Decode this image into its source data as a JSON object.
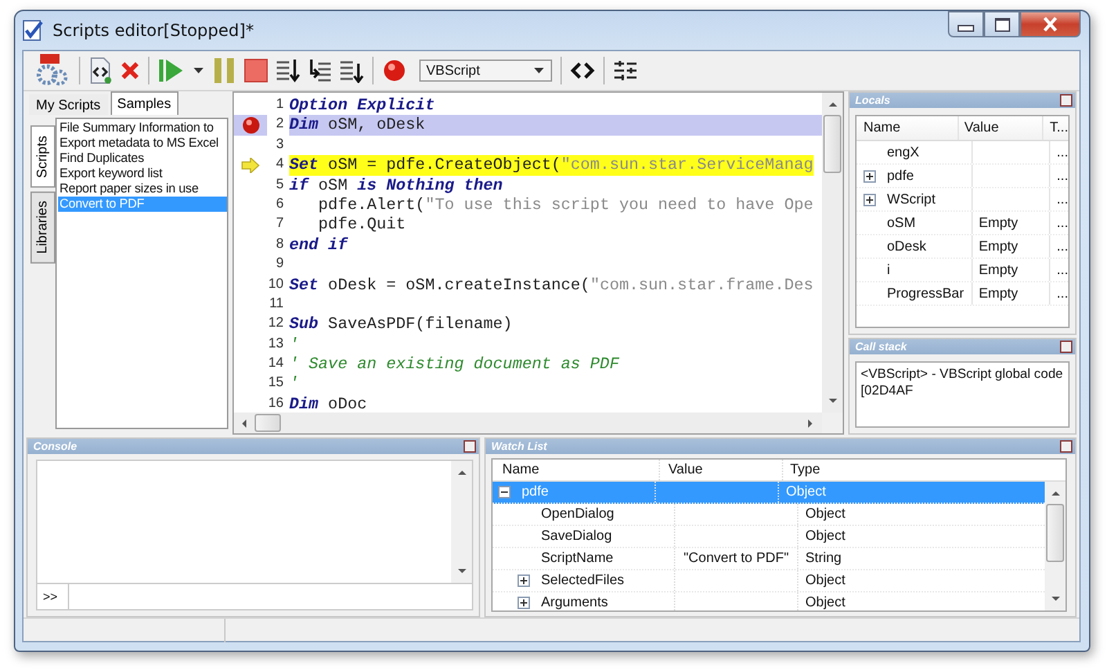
{
  "window": {
    "title": "Scripts editor[Stopped]*"
  },
  "toolbar": {
    "language": "VBScript"
  },
  "left_panel": {
    "tabs": [
      {
        "label": "My Scripts",
        "selected": false
      },
      {
        "label": "Samples",
        "selected": true
      }
    ],
    "side_tabs": [
      {
        "label": "Scripts",
        "selected": true
      },
      {
        "label": "Libraries",
        "selected": false
      }
    ],
    "scripts": [
      {
        "label": "File Summary Information to",
        "selected": false
      },
      {
        "label": "Export metadata to MS Excel",
        "selected": false
      },
      {
        "label": "Find Duplicates",
        "selected": false
      },
      {
        "label": "Export keyword list",
        "selected": false
      },
      {
        "label": "Report paper sizes in use",
        "selected": false
      },
      {
        "label": "Convert to PDF",
        "selected": true
      }
    ]
  },
  "editor": {
    "lines": [
      {
        "number": "1",
        "tokens": [
          {
            "kind": "kw",
            "text": "Option Explicit"
          }
        ]
      },
      {
        "number": "2",
        "breakpoint": true,
        "tokens": [
          {
            "kind": "kw",
            "text": "Dim"
          },
          {
            "kind": "id",
            "text": " oSM, oDesk"
          }
        ]
      },
      {
        "number": "3"
      },
      {
        "number": "4",
        "current": true,
        "tokens": [
          {
            "kind": "kw",
            "text": "Set"
          },
          {
            "kind": "id",
            "text": " oSM = pdfe.CreateObject("
          },
          {
            "kind": "str",
            "text": "\"com.sun.star.ServiceManag"
          }
        ]
      },
      {
        "number": "5",
        "tokens": [
          {
            "kind": "kw",
            "text": "if"
          },
          {
            "kind": "id",
            "text": " oSM "
          },
          {
            "kind": "kw",
            "text": "is Nothing then"
          }
        ]
      },
      {
        "number": "6",
        "tokens": [
          {
            "kind": "id",
            "text": "   pdfe.Alert("
          },
          {
            "kind": "str",
            "text": "\"To use this script you need to have Ope"
          }
        ]
      },
      {
        "number": "7",
        "tokens": [
          {
            "kind": "id",
            "text": "   pdfe.Quit"
          }
        ]
      },
      {
        "number": "8",
        "tokens": [
          {
            "kind": "kw",
            "text": "end if"
          }
        ]
      },
      {
        "number": "9"
      },
      {
        "number": "10",
        "tokens": [
          {
            "kind": "kw",
            "text": "Set"
          },
          {
            "kind": "id",
            "text": " oDesk = oSM.createInstance("
          },
          {
            "kind": "str",
            "text": "\"com.sun.star.frame.Des"
          }
        ]
      },
      {
        "number": "11"
      },
      {
        "number": "12",
        "tokens": [
          {
            "kind": "kw",
            "text": "Sub"
          },
          {
            "kind": "id",
            "text": " SaveAsPDF(filename)"
          }
        ]
      },
      {
        "number": "13",
        "tokens": [
          {
            "kind": "com",
            "text": "'"
          }
        ]
      },
      {
        "number": "14",
        "tokens": [
          {
            "kind": "com",
            "text": "' Save an existing document as PDF"
          }
        ]
      },
      {
        "number": "15",
        "tokens": [
          {
            "kind": "com",
            "text": "'"
          }
        ]
      },
      {
        "number": "16",
        "tokens": [
          {
            "kind": "kw",
            "text": "Dim"
          },
          {
            "kind": "id",
            "text": " oDoc"
          }
        ]
      }
    ]
  },
  "locals": {
    "title": "Locals",
    "columns": [
      "Name",
      "Value",
      "T..."
    ],
    "rows": [
      {
        "name": "engX",
        "type": "...",
        "kind": "leaf"
      },
      {
        "name": "pdfe",
        "type": "...",
        "kind": "node",
        "expanded": false
      },
      {
        "name": "WScript",
        "type": "...",
        "kind": "node",
        "expanded": false
      },
      {
        "name": "oSM",
        "value": "Empty",
        "type": "...",
        "kind": "leaf"
      },
      {
        "name": "oDesk",
        "value": "Empty",
        "type": "...",
        "kind": "leaf"
      },
      {
        "name": "i",
        "value": "Empty",
        "type": "...",
        "kind": "leaf"
      },
      {
        "name": "ProgressBar",
        "value": "Empty",
        "type": "...",
        "kind": "leaf"
      }
    ]
  },
  "call_stack": {
    "title": "Call stack",
    "entries": [
      "<VBScript> - VBScript global code [02D4AF"
    ]
  },
  "console": {
    "title": "Console",
    "prompt": ">>"
  },
  "watch_list": {
    "title": "Watch List",
    "columns": [
      "Name",
      "Value",
      "Type"
    ],
    "rows": [
      {
        "name": "pdfe",
        "type": "Object",
        "kind": "node",
        "expanded": true,
        "selected": true,
        "children": [
          {
            "name": "OpenDialog",
            "type": "Object",
            "kind": "leaf",
            "selected": false
          },
          {
            "name": "SaveDialog",
            "type": "Object",
            "kind": "leaf",
            "selected": false
          },
          {
            "name": "ScriptName",
            "value": "\"Convert to PDF\"",
            "type": "String",
            "kind": "leaf",
            "selected": false
          },
          {
            "name": "SelectedFiles",
            "type": "Object",
            "kind": "node",
            "expanded": false,
            "selected": false
          },
          {
            "name": "Arguments",
            "type": "Object",
            "kind": "node",
            "expanded": false,
            "selected": false
          }
        ]
      }
    ]
  }
}
